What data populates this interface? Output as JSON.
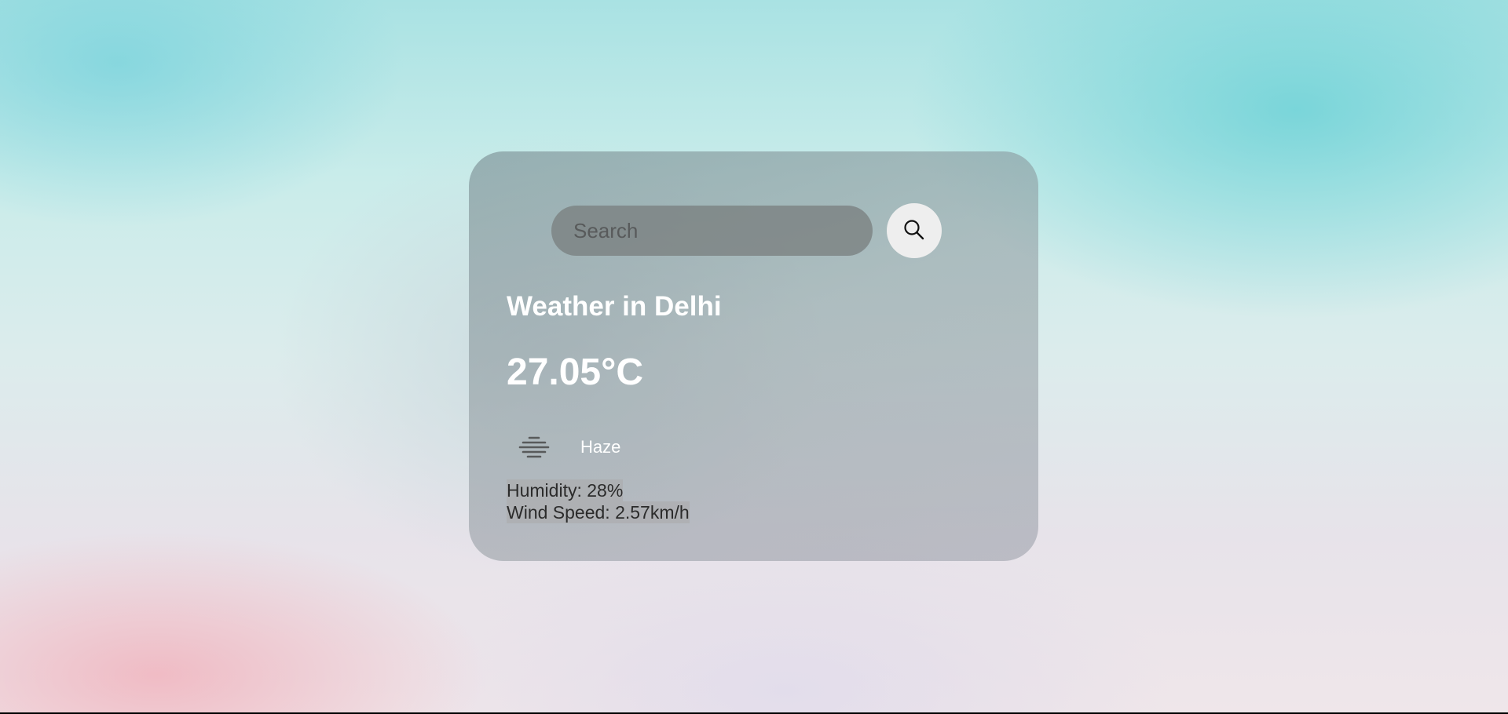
{
  "search": {
    "placeholder": "Search",
    "value": ""
  },
  "weather": {
    "title": "Weather in Delhi",
    "temperature": "27.05°C",
    "condition": "Haze",
    "condition_icon": "haze-icon",
    "humidity": "Humidity: 28%",
    "wind_speed": "Wind Speed: 2.57km/h"
  },
  "icons": {
    "search_button": "search-icon"
  },
  "colors": {
    "card_overlay": "#8c969b",
    "search_field": "#7d8080",
    "search_button": "#eeeeee",
    "text_primary": "#ffffff",
    "text_secondary": "#2b2b2b"
  }
}
